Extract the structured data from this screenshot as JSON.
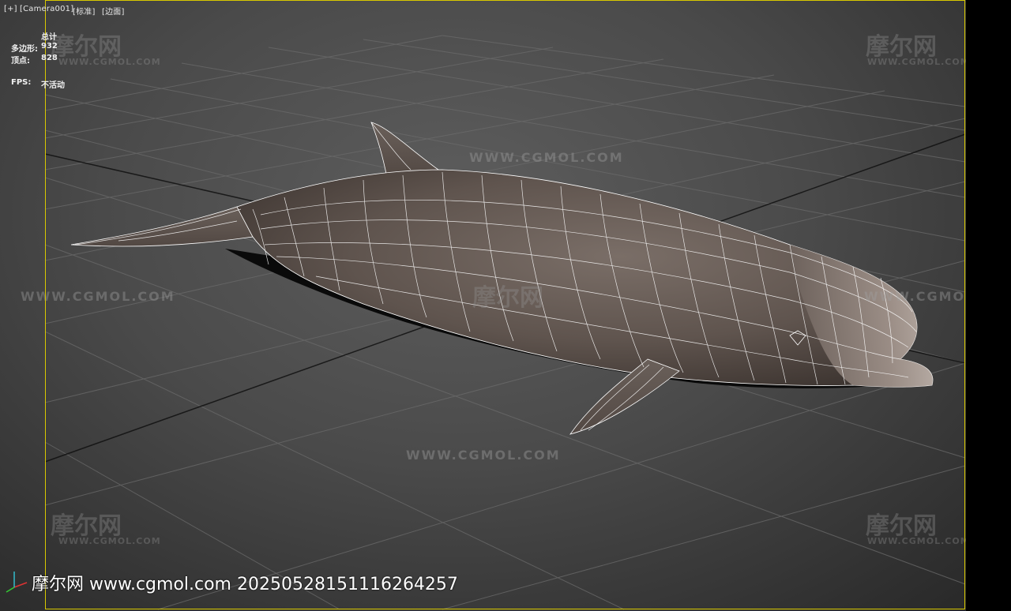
{
  "viewport": {
    "menus": [
      "[+]",
      "[Camera001]",
      "[标准]",
      "[边面]"
    ],
    "stats": {
      "total_label": "总计",
      "polys_label": "多边形:",
      "polys_value": "932",
      "verts_label": "顶点:",
      "verts_value": "828",
      "fps_label": "FPS:",
      "fps_value": "不活动"
    }
  },
  "watermarks": {
    "brand_cn": "摩尔网",
    "brand_en": "WWW.CGMOL.COM",
    "url_line": "WWW.CGMOL.COM"
  },
  "footer": {
    "text": "摩尔网 www.cgmol.com 20250528151116264257"
  },
  "colors": {
    "viewport_border": "#d8c800",
    "dolphin_body": "#6e625c",
    "wire": "#ffffff"
  },
  "icons": {
    "axis_gizmo": "axis-gizmo-icon"
  }
}
